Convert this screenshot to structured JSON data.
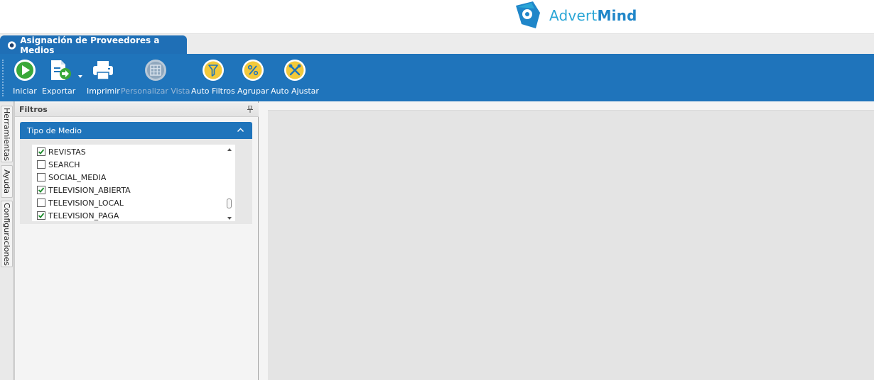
{
  "brand": {
    "name_light": "Advert",
    "name_bold": "Mind",
    "color_light": "#2aa6d6",
    "color_bold": "#1f86c9"
  },
  "tab": {
    "title": "Asignación de Proveedores a Medios",
    "icon": "eye-icon"
  },
  "toolbar": {
    "iniciar": "Iniciar",
    "exportar": "Exportar",
    "imprimir": "Imprimir",
    "personalizar": "Personalizar Vista",
    "auto_filtros": "Auto Filtros",
    "agrupar": "Agrupar",
    "auto_ajustar": "Auto Ajustar"
  },
  "side_tabs": [
    "Herramientas",
    "Ayuda",
    "Configuraciones"
  ],
  "filters": {
    "title": "Filtros",
    "group_title": "Tipo de Medio",
    "items": [
      {
        "label": "REVISTAS",
        "checked": true
      },
      {
        "label": "SEARCH",
        "checked": false
      },
      {
        "label": "SOCIAL_MEDIA",
        "checked": false
      },
      {
        "label": "TELEVISION_ABIERTA",
        "checked": true
      },
      {
        "label": "TELEVISION_LOCAL",
        "checked": false
      },
      {
        "label": "TELEVISION_PAGA",
        "checked": true
      }
    ]
  },
  "colors": {
    "ribbon": "#1f74bb",
    "tab": "#1f6fb6",
    "check": "#1b8a2a",
    "workspace": "#e4e4e4"
  }
}
